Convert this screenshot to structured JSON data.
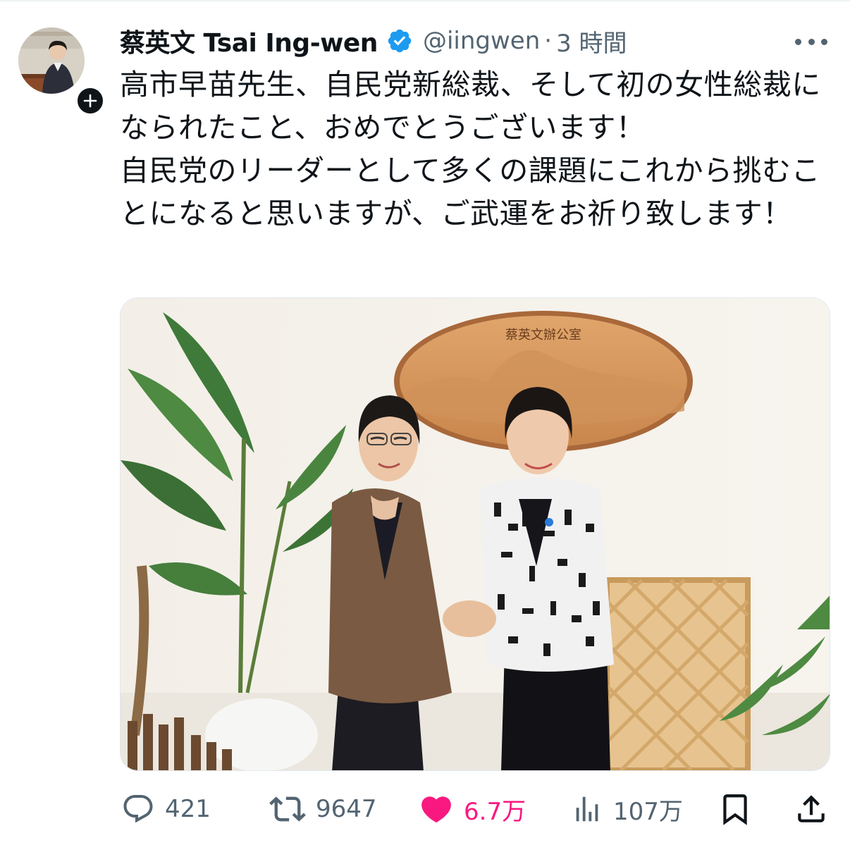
{
  "tweet": {
    "author": {
      "display_name": "蔡英文 Tsai Ing-wen",
      "handle": "@iingwen",
      "separator": "·",
      "time": "3 時間",
      "verified": true,
      "avatar_icon": "profile-photo",
      "follow_icon": "plus-icon"
    },
    "text": "高市早苗先生、自民党新総裁、そして初の女性総裁になられたこと、おめでとうございます！\n自民党のリーダーとして多くの課題にこれから挑むことになると思いますが、ご武運をお祈り致します！",
    "media": {
      "type": "photo",
      "plaque_text": "蔡英文辦公室"
    },
    "actions": {
      "reply": {
        "icon": "reply-icon",
        "count": "421"
      },
      "retweet": {
        "icon": "retweet-icon",
        "count": "9647"
      },
      "like": {
        "icon": "heart-filled-icon",
        "count": "6.7万",
        "liked": true
      },
      "views": {
        "icon": "views-icon",
        "count": "107万"
      },
      "bookmark": {
        "icon": "bookmark-icon"
      },
      "share": {
        "icon": "share-icon"
      }
    },
    "colors": {
      "text": "#0f1419",
      "secondary": "#536471",
      "verified": "#1d9bf0",
      "like": "#f91880"
    }
  }
}
